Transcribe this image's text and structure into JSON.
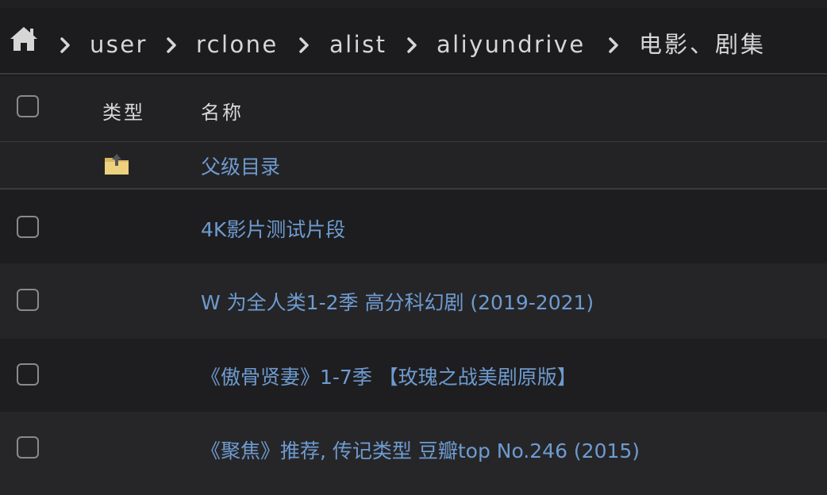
{
  "breadcrumb": {
    "home_icon": "home-icon",
    "separator_icon": "chevron-right-icon",
    "items": [
      "user",
      "rclone",
      "alist",
      "aliyundrive",
      "电影、剧集"
    ]
  },
  "table": {
    "headers": {
      "type": "类型",
      "name": "名称"
    },
    "parent_dir": {
      "label": "父级目录",
      "icon": "folder-up-icon"
    },
    "rows": [
      {
        "name": "4K影片测试片段"
      },
      {
        "name": "W 为全人类1-2季 高分科幻剧 (2019-2021)"
      },
      {
        "name": "《傲骨贤妻》1-7季 【玫瑰之战美剧原版】"
      },
      {
        "name": "《聚焦》推荐, 传记类型 豆瓣top No.246 (2015)"
      }
    ]
  },
  "colors": {
    "background": "#1b1b1d",
    "link": "#6e9bd0",
    "text": "#d6d6d6"
  }
}
